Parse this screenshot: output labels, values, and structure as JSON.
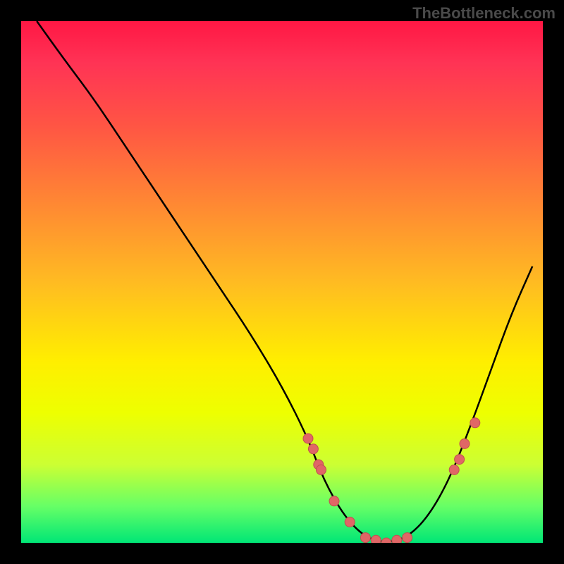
{
  "watermark": "TheBottleneck.com",
  "chart_data": {
    "type": "line",
    "title": "",
    "xlabel": "",
    "ylabel": "",
    "xlim": [
      0,
      100
    ],
    "ylim": [
      0,
      100
    ],
    "curve": {
      "name": "bottleneck-curve",
      "x": [
        3,
        8,
        14,
        20,
        26,
        32,
        38,
        44,
        50,
        55,
        58,
        62,
        66,
        70,
        74,
        78,
        82,
        86,
        90,
        94,
        98
      ],
      "y": [
        100,
        93,
        85,
        76,
        67,
        58,
        49,
        40,
        30,
        20,
        12,
        5,
        1,
        0,
        1,
        5,
        12,
        22,
        33,
        44,
        53
      ]
    },
    "highlight_points": {
      "name": "highlighted-configs",
      "x": [
        55,
        56,
        57,
        57.5,
        60,
        63,
        66,
        68,
        70,
        72,
        74,
        83,
        84,
        85,
        87
      ],
      "y": [
        20,
        18,
        15,
        14,
        8,
        4,
        1,
        0.5,
        0,
        0.5,
        1,
        14,
        16,
        19,
        23
      ]
    },
    "gradient_stops": [
      {
        "pos": 0,
        "color": "#ff1744"
      },
      {
        "pos": 50,
        "color": "#ffee00"
      },
      {
        "pos": 100,
        "color": "#00e676"
      }
    ]
  }
}
